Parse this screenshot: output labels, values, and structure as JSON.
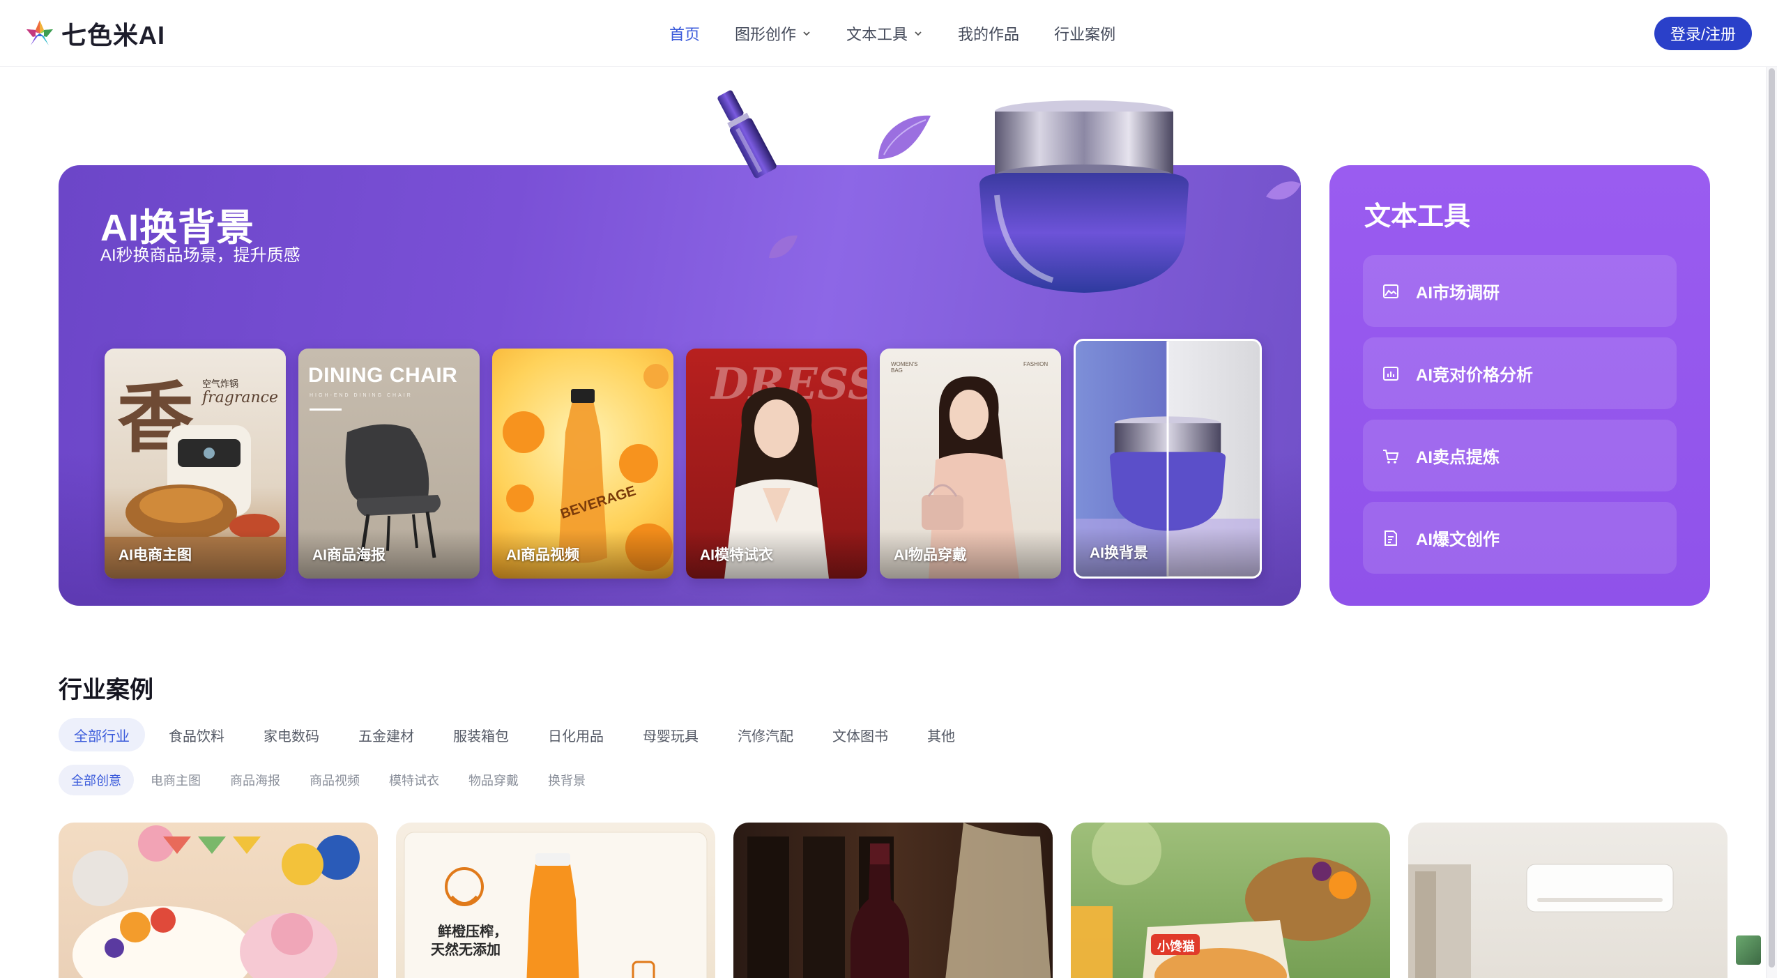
{
  "header": {
    "logo_text": "七色米AI",
    "nav": [
      {
        "label": "首页",
        "active": true,
        "dropdown": false
      },
      {
        "label": "图形创作",
        "active": false,
        "dropdown": true
      },
      {
        "label": "文本工具",
        "active": false,
        "dropdown": true
      },
      {
        "label": "我的作品",
        "active": false,
        "dropdown": false
      },
      {
        "label": "行业案例",
        "active": false,
        "dropdown": false
      }
    ],
    "login_label": "登录/注册"
  },
  "hero": {
    "title": "AI换背景",
    "subtitle": "AI秒换商品场景，提升质感",
    "cards": [
      {
        "label": "AI电商主图",
        "icon": "air-fryer-image",
        "active": false
      },
      {
        "label": "AI商品海报",
        "icon": "dining-chair-image",
        "active": false
      },
      {
        "label": "AI商品视频",
        "icon": "orange-beverage-image",
        "active": false
      },
      {
        "label": "AI模特试衣",
        "icon": "dress-model-image",
        "active": false
      },
      {
        "label": "AI物品穿戴",
        "icon": "bag-model-image",
        "active": false
      },
      {
        "label": "AI换背景",
        "icon": "cream-jar-image",
        "active": true
      }
    ],
    "card_texts": {
      "fryer_big_char": "香",
      "fryer_small_1": "空气炸锅",
      "fryer_small_2": "fragrance",
      "chair_title": "DINING CHAIR",
      "chair_sub": "HIGH-END DINING CHAIR",
      "beverage_word": "BEVERAGE",
      "dress_word": "DRESS",
      "bag_top_left": "WOMEN'S BAG",
      "bag_top_right": "FASHION"
    }
  },
  "tools": {
    "title": "文本工具",
    "items": [
      {
        "label": "AI市场调研",
        "icon": "image-chart-icon"
      },
      {
        "label": "AI竞对价格分析",
        "icon": "bar-chart-icon"
      },
      {
        "label": "AI卖点提炼",
        "icon": "shopping-cart-icon"
      },
      {
        "label": "AI爆文创作",
        "icon": "document-edit-icon"
      }
    ]
  },
  "industry": {
    "title": "行业案例",
    "categories": [
      "全部行业",
      "食品饮料",
      "家电数码",
      "五金建材",
      "服装箱包",
      "日化用品",
      "母婴玩具",
      "汽修汽配",
      "文体图书",
      "其他"
    ],
    "active_category": 0,
    "creative_types": [
      "全部创意",
      "电商主图",
      "商品海报",
      "商品视频",
      "模特试衣",
      "物品穿戴",
      "换背景"
    ],
    "active_creative": 0,
    "gallery": [
      {
        "icon": "birthday-cake-image"
      },
      {
        "icon": "orange-juice-image",
        "caption_1": "鲜橙压榨，",
        "caption_2": "天然无添加"
      },
      {
        "icon": "wine-bottle-image"
      },
      {
        "icon": "cracker-snack-image",
        "badge": "小馋猫"
      },
      {
        "icon": "air-conditioner-image"
      }
    ]
  },
  "colors": {
    "primary": "#2a40c9",
    "nav_active": "#3b5bdb",
    "hero_purple": "#7a50d6",
    "tools_purple": "#9a5cf0"
  }
}
